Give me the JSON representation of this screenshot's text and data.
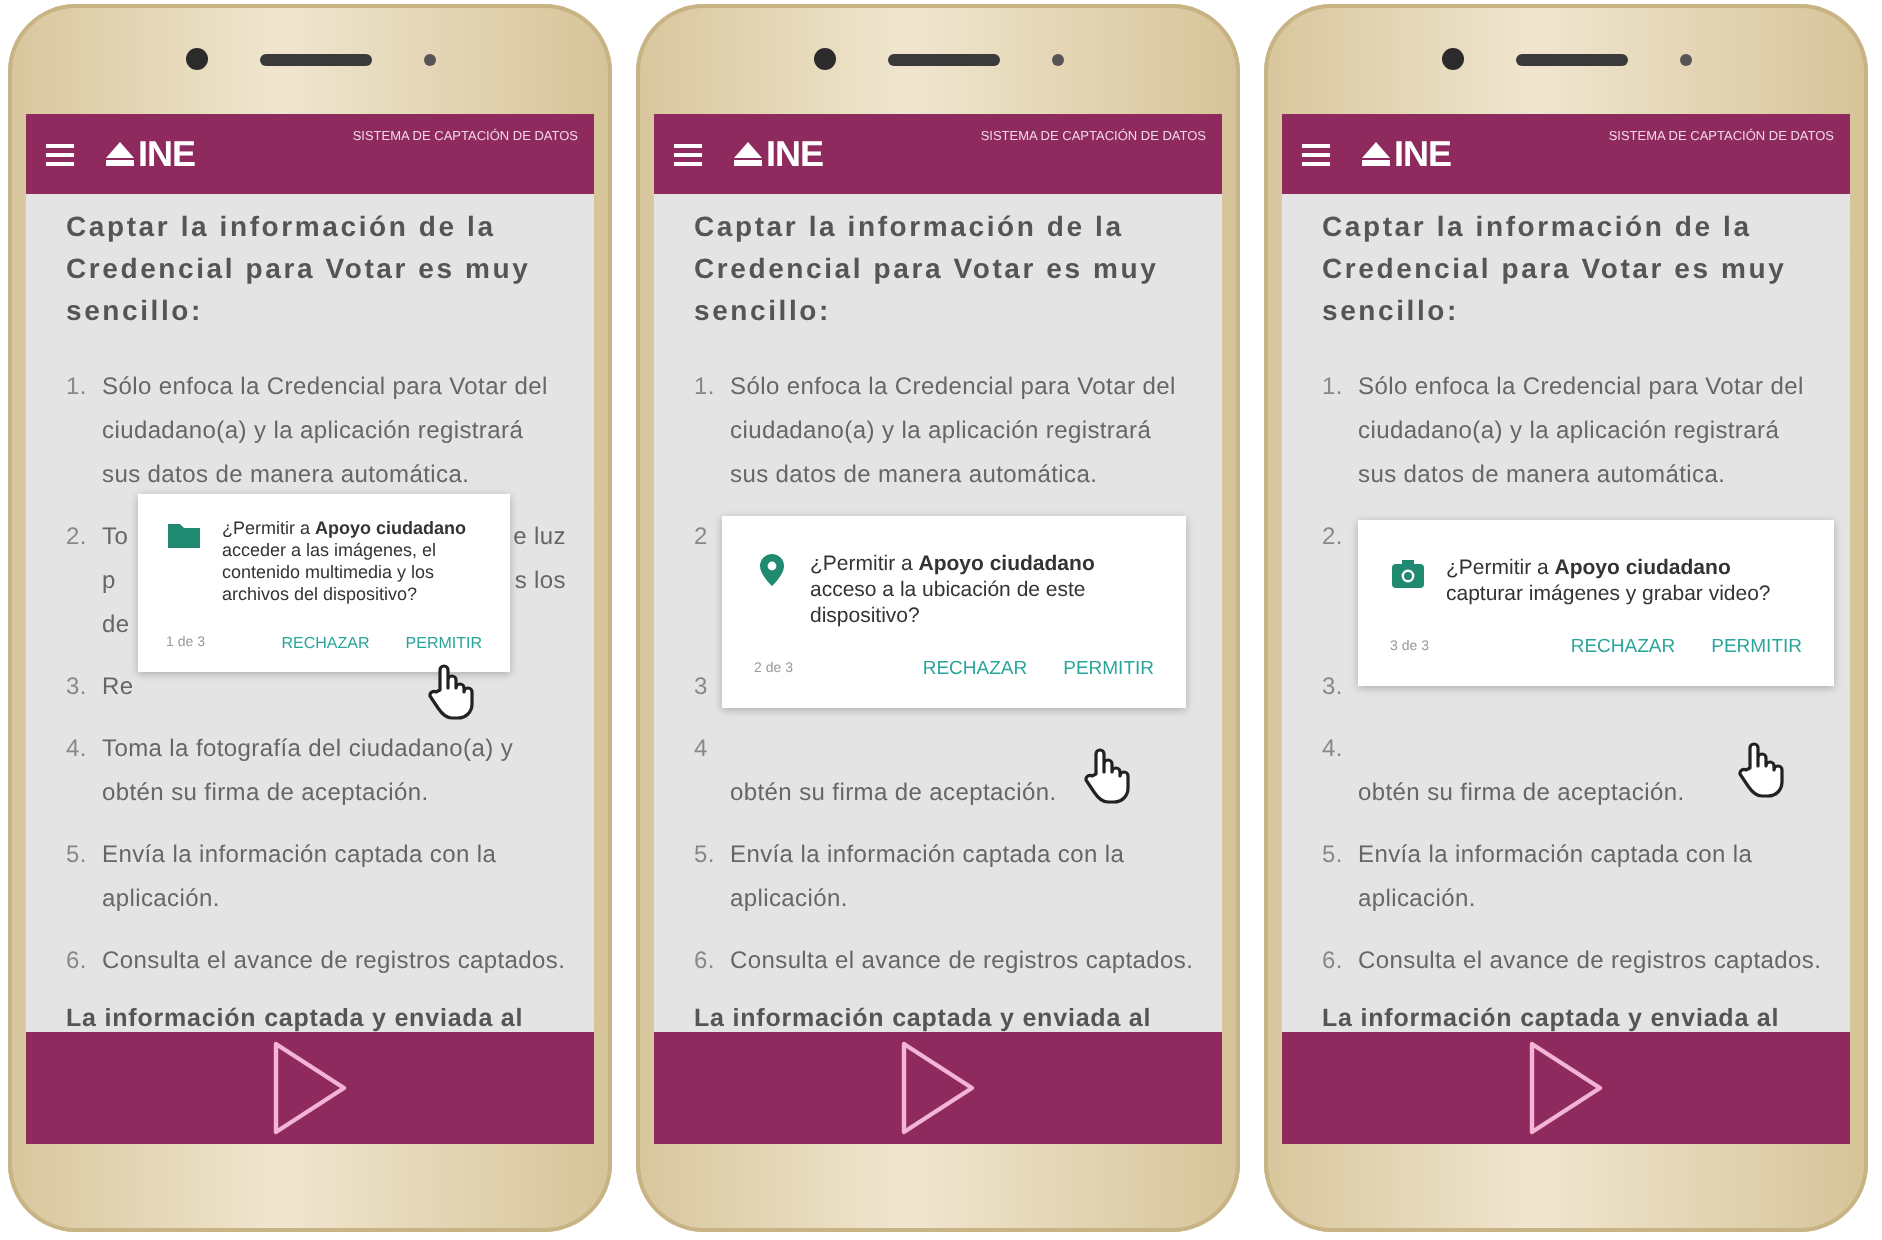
{
  "phones": [
    {
      "header": {
        "logo_text": "INE",
        "title": "SISTEMA DE CAPTACIÓN DE DATOS"
      },
      "heading": "Captar la información de la Credencial para Votar es muy sencillo:",
      "items": [
        {
          "number": "1.",
          "text": "Sólo enfoca la Credencial para Votar del ciudadano(a) y la aplicación registrará sus datos de manera automática."
        },
        {
          "number": "2.",
          "lines": [
            {
              "left": "To",
              "right": "e luz"
            },
            {
              "left": "p",
              "right": "s los"
            },
            {
              "left": "de"
            }
          ]
        },
        {
          "number": "3.",
          "lines": [
            {
              "left": "Re"
            }
          ]
        },
        {
          "number": "4.",
          "text": "Toma la fotografía del ciudadano(a) y obtén su firma de aceptación."
        },
        {
          "number": "5.",
          "text": "Envía la información captada con la aplicación."
        },
        {
          "number": "6.",
          "text": "Consulta el avance de registros captados."
        }
      ],
      "footer_text": "La información captada y enviada al",
      "dialog": {
        "text": "¿Permitir a **Apoyo ciudadano** acceder a las imágenes, el contenido multimedia y los archivos del dispositivo?",
        "counter": "1 de 3",
        "buttons": [
          "RECHAZAR",
          "PERMITIR"
        ]
      }
    },
    {
      "header": {
        "logo_text": "INE",
        "title": "SISTEMA DE CAPTACIÓN DE DATOS"
      },
      "heading": "Captar la información de la Credencial para Votar es muy sencillo:",
      "items": [
        {
          "number": "1.",
          "text": "Sólo enfoca la Credencial para Votar del ciudadano(a) y la aplicación registrará sus datos de manera automática."
        },
        {
          "number": "2"
        },
        {
          "number": "3"
        },
        {
          "number": "4",
          "text": "obtén su firma de aceptación."
        },
        {
          "number": "5.",
          "text": "Envía la información captada con la aplicación."
        },
        {
          "number": "6.",
          "text": "Consulta el avance de registros captados."
        }
      ],
      "footer_text": "La información captada y enviada al",
      "dialog": {
        "text": "¿Permitir a **Apoyo ciudadano** acceso a la ubicación de este dispositivo?",
        "counter": "2 de 3",
        "buttons": [
          "RECHAZAR",
          "PERMITIR"
        ]
      }
    },
    {
      "header": {
        "logo_text": "INE",
        "title": "SISTEMA DE CAPTACIÓN DE DATOS"
      },
      "heading": "Captar la información de la Credencial para Votar es muy sencillo:",
      "items": [
        {
          "number": "1.",
          "text": "Sólo enfoca la Credencial para Votar del ciudadano(a) y la aplicación registrará sus datos de manera automática."
        },
        {
          "number": "2."
        },
        {
          "number": "3."
        },
        {
          "number": "4.",
          "text": "obtén su firma de aceptación."
        },
        {
          "number": "5.",
          "text": "Envía la información captada con la aplicación."
        },
        {
          "number": "6.",
          "text": "Consulta el avance de registros captados."
        }
      ],
      "footer_text": "La información captada y enviada al",
      "dialog": {
        "text": "¿Permitir a **Apoyo ciudadano** capturar imágenes y grabar video?",
        "counter": "3 de 3",
        "buttons": [
          "RECHAZAR",
          "PERMITIR"
        ]
      }
    }
  ]
}
